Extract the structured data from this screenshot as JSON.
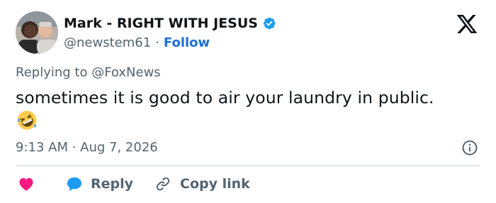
{
  "author": {
    "display_name": "Mark - RIGHT WITH JESUS",
    "handle": "@newstem61",
    "separator": "·",
    "follow_label": "Follow"
  },
  "tweet": {
    "replying_prefix": "Replying to",
    "replying_to": "@FoxNews",
    "text": "sometimes it is good to air your laundry in public.",
    "emoji": "🤣",
    "timestamp": "9:13 AM · Aug 7, 2026"
  },
  "actions": {
    "reply_label": "Reply",
    "copy_link_label": "Copy link"
  },
  "colors": {
    "link": "#1d6fd6",
    "secondary_text": "#536471",
    "like_heart": "#f91880",
    "reply_bubble": "#1d9bf0",
    "verified_badge": "#1d9bf0",
    "divider": "#cfd9de"
  },
  "icons": [
    "verified-badge-icon",
    "x-logo-icon",
    "info-icon",
    "heart-icon",
    "reply-bubble-icon",
    "link-icon"
  ]
}
